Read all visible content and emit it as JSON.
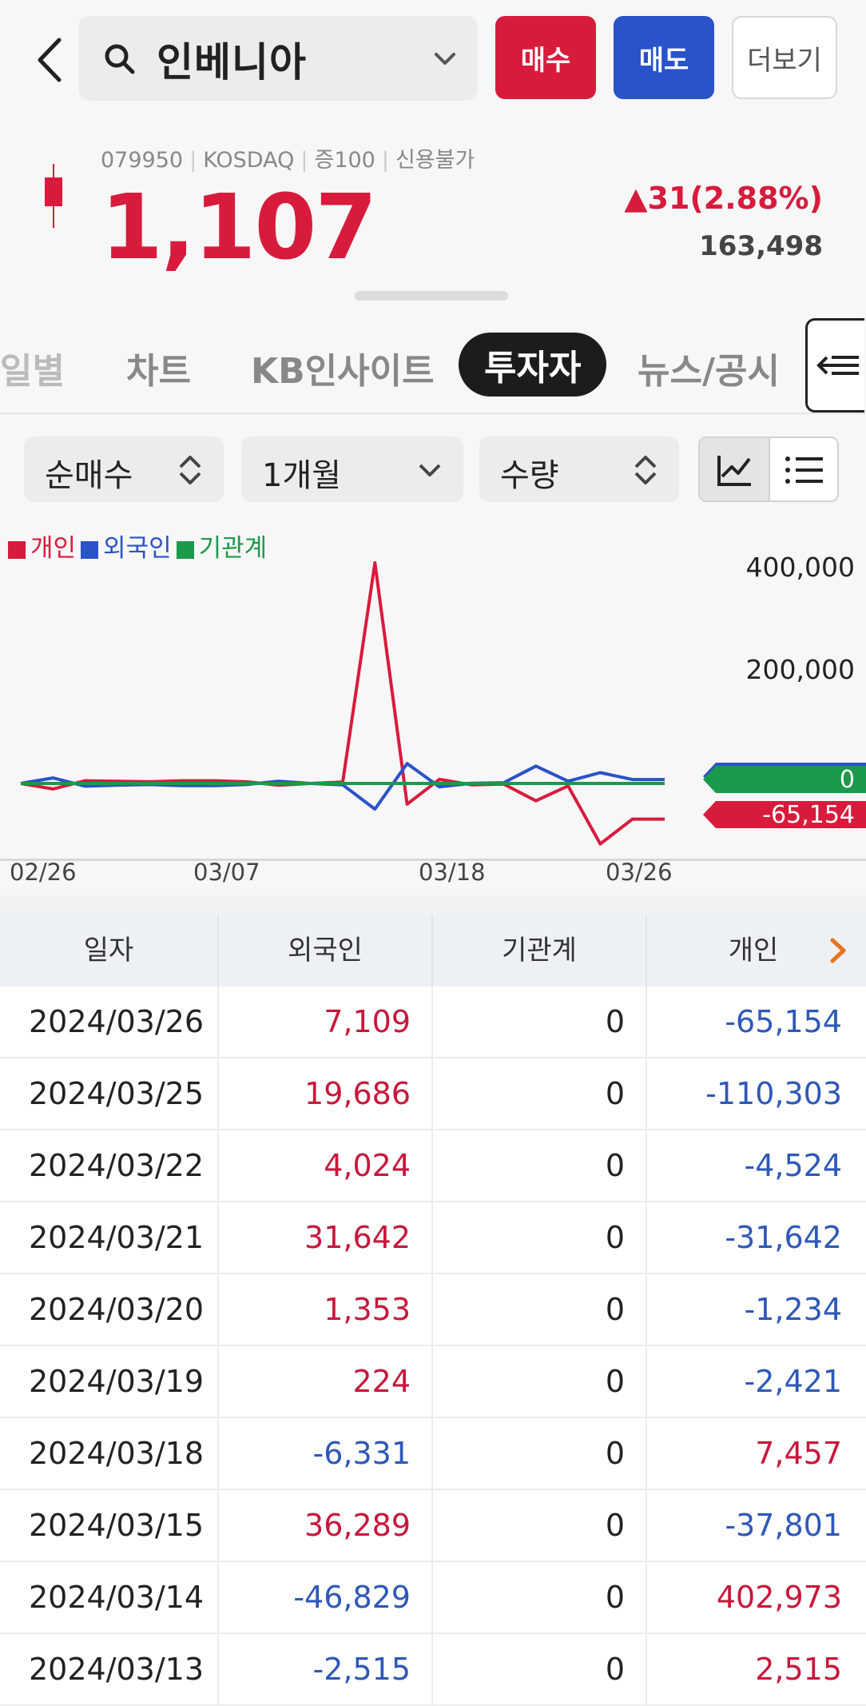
{
  "header": {
    "stock_name": "인베니아",
    "buy_label": "매수",
    "sell_label": "매도",
    "more_label": "더보기"
  },
  "quote": {
    "code": "079950",
    "market": "KOSDAQ",
    "margin": "증100",
    "credit": "신용불가",
    "price": "1,107",
    "change": "▲31(2.88%)",
    "volume": "163,498"
  },
  "tabs": [
    {
      "label": "일별"
    },
    {
      "label": "차트"
    },
    {
      "label": "KB인사이트"
    },
    {
      "label": "투자자"
    },
    {
      "label": "뉴스/공시"
    }
  ],
  "filters": {
    "type": "순매수",
    "period": "1개월",
    "unit": "수량"
  },
  "legend": {
    "individual": "개인",
    "foreign": "외국인",
    "institution": "기관계"
  },
  "colors": {
    "up": "#d81b3c",
    "down": "#2a52c9",
    "institution": "#1a9a4a"
  },
  "chart_data": {
    "type": "line",
    "x": [
      "02/26",
      "02/27",
      "02/28",
      "02/29",
      "03/04",
      "03/05",
      "03/06",
      "03/07",
      "03/08",
      "03/11",
      "03/12",
      "03/13",
      "03/14",
      "03/15",
      "03/18",
      "03/19",
      "03/20",
      "03/21",
      "03/22",
      "03/25",
      "03/26"
    ],
    "xticks": [
      "02/26",
      "03/07",
      "03/18",
      "03/26"
    ],
    "yticks": [
      "400,000",
      "200,000"
    ],
    "ylim": [
      -120000,
      420000
    ],
    "series": [
      {
        "name": "개인",
        "color": "#d81b3c",
        "values": [
          0,
          -10000,
          5000,
          4000,
          3000,
          5000,
          5000,
          3000,
          -3000,
          0,
          2515,
          402973,
          -37801,
          7457,
          -2421,
          -1234,
          -31642,
          -4524,
          -110303,
          -65154,
          -65154
        ]
      },
      {
        "name": "외국인",
        "color": "#2a52c9",
        "values": [
          0,
          10000,
          -5000,
          -3000,
          -2000,
          -4000,
          -4000,
          -2000,
          4000,
          0,
          -2515,
          -46829,
          36289,
          -6331,
          224,
          1353,
          31642,
          4024,
          19686,
          7109,
          7109
        ]
      },
      {
        "name": "기관계",
        "color": "#1a9a4a",
        "values": [
          0,
          0,
          0,
          0,
          0,
          0,
          0,
          0,
          0,
          0,
          0,
          0,
          0,
          0,
          0,
          0,
          0,
          0,
          0,
          0,
          0
        ]
      }
    ],
    "end_labels": [
      {
        "text": "7,109",
        "color": "#2a52c9"
      },
      {
        "text": "0",
        "color": "#1a9a4a"
      },
      {
        "text": "-65,154",
        "color": "#d81b3c"
      }
    ]
  },
  "table": {
    "headers": [
      "일자",
      "외국인",
      "기관계",
      "개인"
    ],
    "rows": [
      {
        "date": "2024/03/26",
        "foreign": "7,109",
        "inst": "0",
        "indiv": "-65,154"
      },
      {
        "date": "2024/03/25",
        "foreign": "19,686",
        "inst": "0",
        "indiv": "-110,303"
      },
      {
        "date": "2024/03/22",
        "foreign": "4,024",
        "inst": "0",
        "indiv": "-4,524"
      },
      {
        "date": "2024/03/21",
        "foreign": "31,642",
        "inst": "0",
        "indiv": "-31,642"
      },
      {
        "date": "2024/03/20",
        "foreign": "1,353",
        "inst": "0",
        "indiv": "-1,234"
      },
      {
        "date": "2024/03/19",
        "foreign": "224",
        "inst": "0",
        "indiv": "-2,421"
      },
      {
        "date": "2024/03/18",
        "foreign": "-6,331",
        "inst": "0",
        "indiv": "7,457"
      },
      {
        "date": "2024/03/15",
        "foreign": "36,289",
        "inst": "0",
        "indiv": "-37,801"
      },
      {
        "date": "2024/03/14",
        "foreign": "-46,829",
        "inst": "0",
        "indiv": "402,973"
      },
      {
        "date": "2024/03/13",
        "foreign": "-2,515",
        "inst": "0",
        "indiv": "2,515"
      }
    ]
  }
}
